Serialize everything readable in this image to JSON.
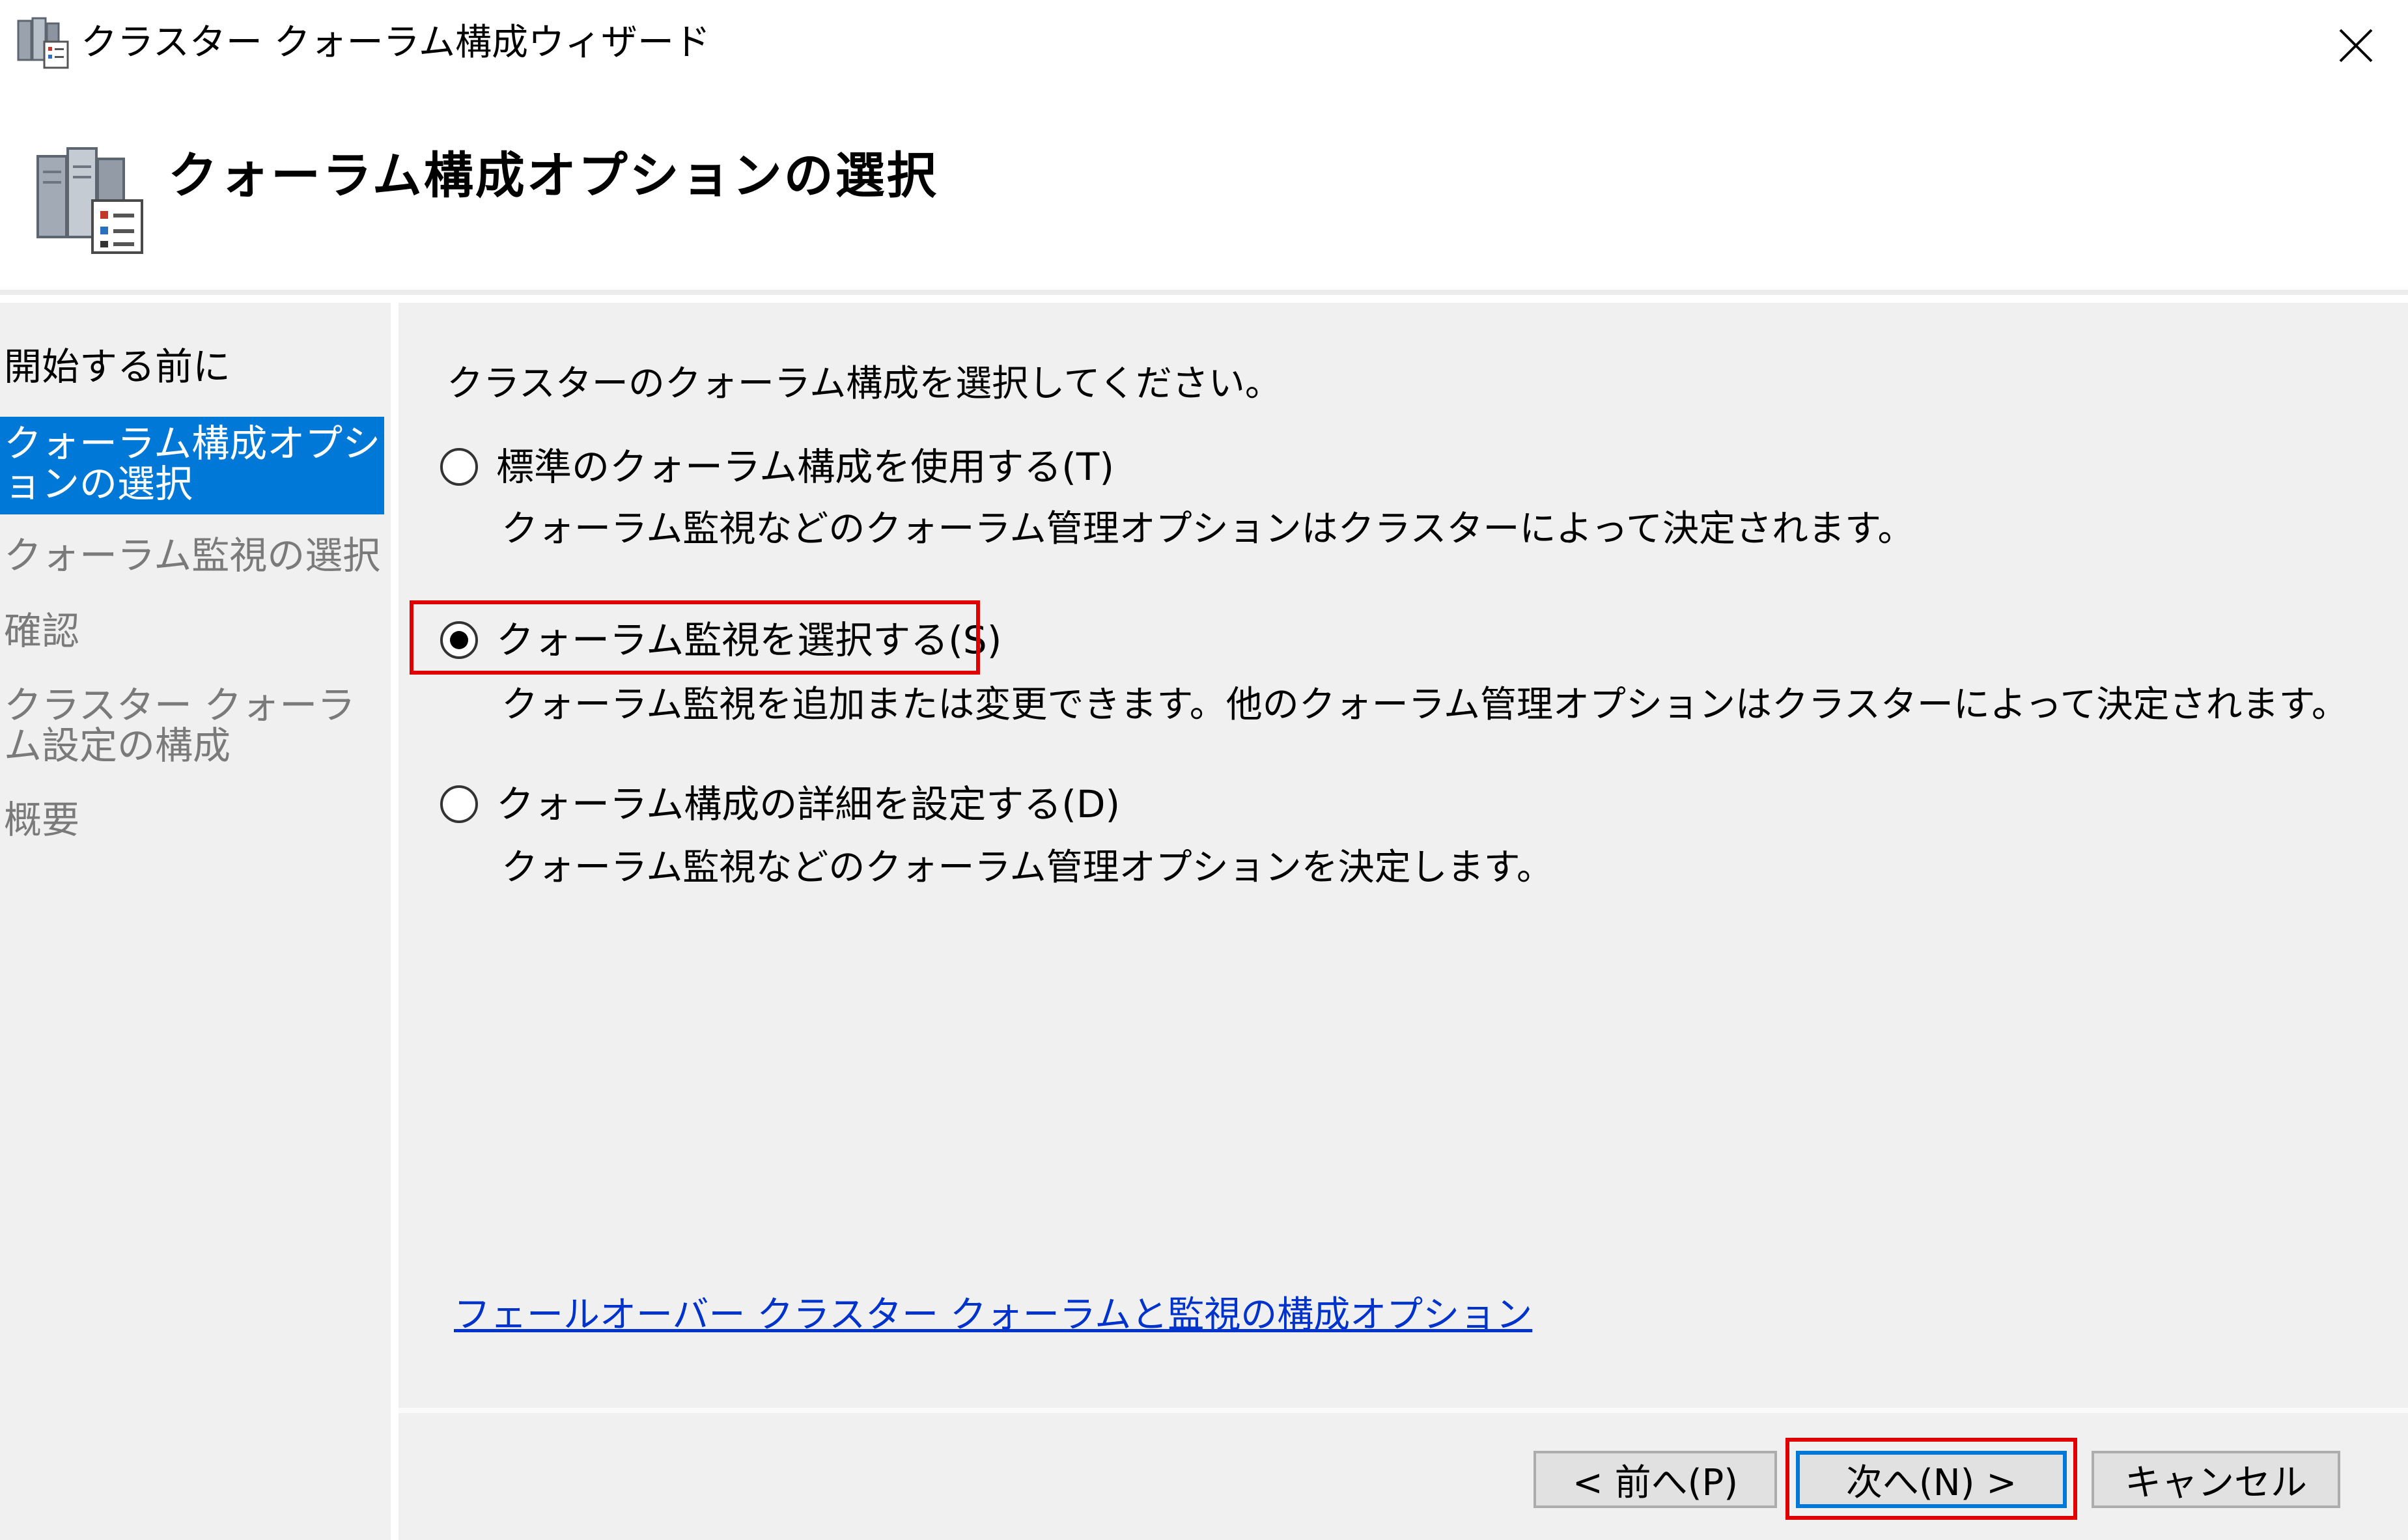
{
  "window": {
    "title": "クラスター クォーラム構成ウィザード"
  },
  "header": {
    "title": "クォーラム構成オプションの選択"
  },
  "sidebar": {
    "items": [
      {
        "label": "開始する前に",
        "state": "normal"
      },
      {
        "label": "クォーラム構成オプションの選択",
        "state": "active"
      },
      {
        "label": "クォーラム監視の選択",
        "state": "disabled"
      },
      {
        "label": "確認",
        "state": "disabled"
      },
      {
        "label": "クラスター クォーラム設定の構成",
        "state": "disabled"
      },
      {
        "label": "概要",
        "state": "disabled"
      }
    ]
  },
  "main": {
    "prompt": "クラスターのクォーラム構成を選択してください。",
    "options": [
      {
        "label": "標準のクォーラム構成を使用する(T)",
        "description": "クォーラム監視などのクォーラム管理オプションはクラスターによって決定されます。",
        "checked": false
      },
      {
        "label": "クォーラム監視を選択する(S)",
        "description": "クォーラム監視を追加または変更できます。他のクォーラム管理オプションはクラスターによって決定されます。",
        "checked": true
      },
      {
        "label": "クォーラム構成の詳細を設定する(D)",
        "description": "クォーラム監視などのクォーラム管理オプションを決定します。",
        "checked": false
      }
    ],
    "link": "フェールオーバー クラスター クォーラムと監視の構成オプション"
  },
  "footer": {
    "back_label": "< 前へ(P)",
    "next_label": "次へ(N) >",
    "cancel_label": "キャンセル"
  },
  "colors": {
    "accent": "#0078d7",
    "highlight_box": "#e00000",
    "link": "#0033cc",
    "panel_background": "#f0f0f0"
  },
  "icons": [
    "cluster-wizard-icon",
    "close-icon",
    "cluster-servers-icon",
    "radio-button-icon"
  ]
}
